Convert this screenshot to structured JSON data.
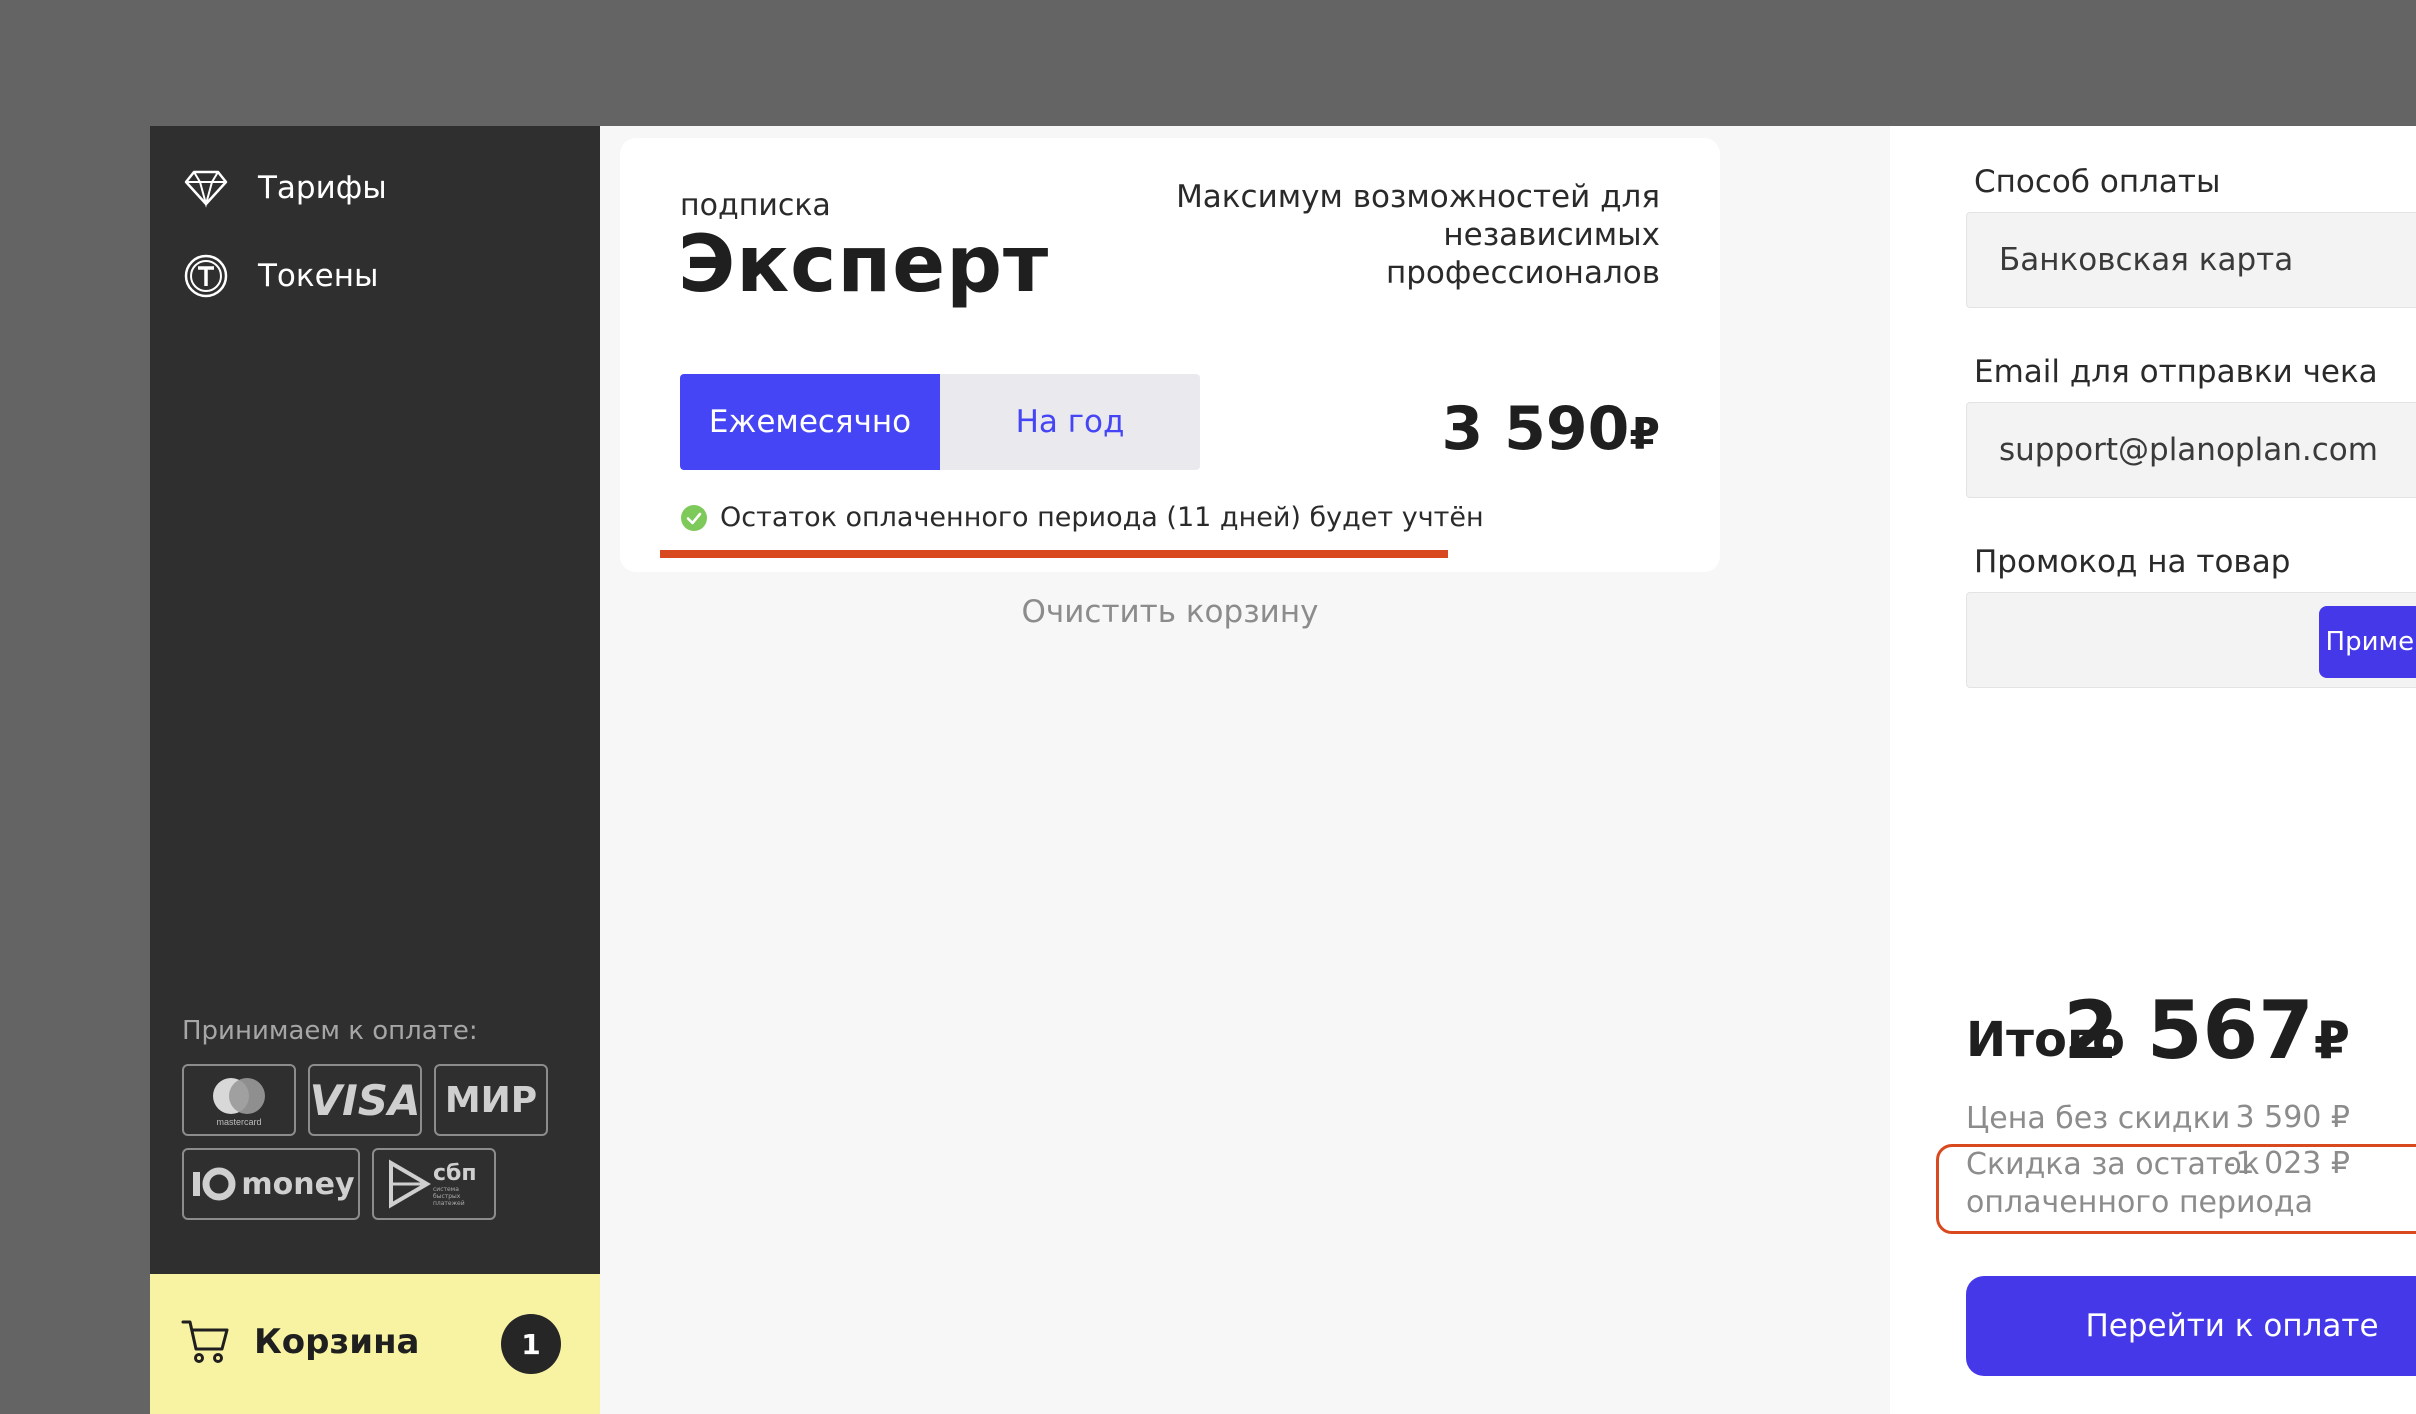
{
  "sidebar": {
    "nav": [
      {
        "label": "Тарифы",
        "icon": "diamond-icon"
      },
      {
        "label": "Токены",
        "icon": "token-icon"
      }
    ],
    "payment_caption": "Принимаем к оплате:",
    "payment_methods": [
      {
        "name": "mastercard",
        "label": "mastercard"
      },
      {
        "name": "visa",
        "label": "VISA"
      },
      {
        "name": "mir",
        "label": "МИР"
      },
      {
        "name": "yoomoney",
        "label": "money"
      },
      {
        "name": "sbp",
        "label": "сбп",
        "sublabel": "система быстрых платежей"
      }
    ],
    "cart": {
      "label": "Корзина",
      "count": "1",
      "icon": "cart-icon"
    }
  },
  "plan": {
    "subscription_label": "подписка",
    "name": "Эксперт",
    "description_lines": [
      "Максимум возможностей для",
      "независимых",
      "профессионалов"
    ],
    "periods": [
      {
        "label": "Ежемесячно",
        "active": true
      },
      {
        "label": "На год",
        "active": false
      }
    ],
    "price": "3 590",
    "currency": "₽",
    "remaining_note": "Остаток оплаченного периода (11 дней) будет учтён"
  },
  "clear_cart_label": "Очистить корзину",
  "checkout": {
    "payment_method_label": "Способ оплаты",
    "payment_method_value": "Банковская карта",
    "email_label": "Email для отправки чека",
    "email_value": "support@planoplan.com",
    "promo_label": "Промокод на товар",
    "promo_value": "",
    "apply_label": "Применить",
    "total_label": "Итого",
    "total_value": "2 567",
    "currency": "₽",
    "price_no_discount_label": "Цена без скидки",
    "price_no_discount_value": "3 590 ₽",
    "discount_label_line1": "Скидка за остаток",
    "discount_label_line2": "оплаченного периода",
    "discount_value": "-1 023 ₽",
    "pay_button_label": "Перейти к оплате"
  },
  "colors": {
    "accent": "#4545f5",
    "button": "#4538e8",
    "highlight": "#d9491f",
    "cart_bg": "#f8f3a3",
    "sidebar_bg": "#2f2f2f"
  }
}
